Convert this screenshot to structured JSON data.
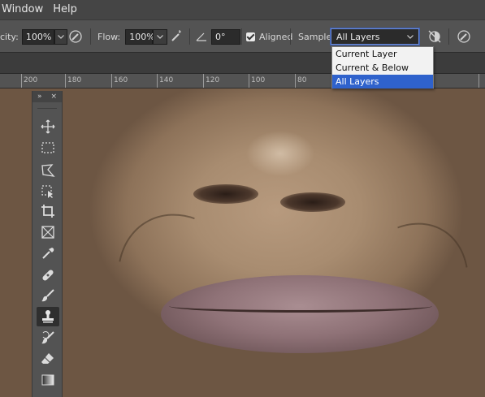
{
  "menubar": {
    "items": [
      "Window",
      "Help"
    ]
  },
  "options": {
    "opacity_label": "city:",
    "opacity_value": "100%",
    "flow_label": "Flow:",
    "flow_value": "100%",
    "angle_value": "0°",
    "aligned_label": "Aligned",
    "aligned_checked": true,
    "sample_label": "Sample:",
    "sample_value": "All Layers"
  },
  "dropdown": {
    "options": [
      "Current Layer",
      "Current & Below",
      "All Layers"
    ],
    "selected": "All Layers"
  },
  "ruler": {
    "labels": [
      "200",
      "180",
      "160",
      "140",
      "120",
      "100",
      "80",
      "60"
    ]
  },
  "tools_panel": {
    "collapse_glyph": "»",
    "close_glyph": "×",
    "tools": [
      "move-icon",
      "rectangular-marquee-icon",
      "lasso-icon",
      "object-selection-icon",
      "crop-icon",
      "frame-icon",
      "eyedropper-icon",
      "spot-healing-icon",
      "brush-icon",
      "clone-stamp-icon",
      "history-brush-icon",
      "eraser-icon",
      "gradient-icon"
    ],
    "active_tool": "clone-stamp-icon"
  },
  "colors": {
    "accent": "#2f62cc",
    "panel": "#535353",
    "menubar": "#454545"
  }
}
